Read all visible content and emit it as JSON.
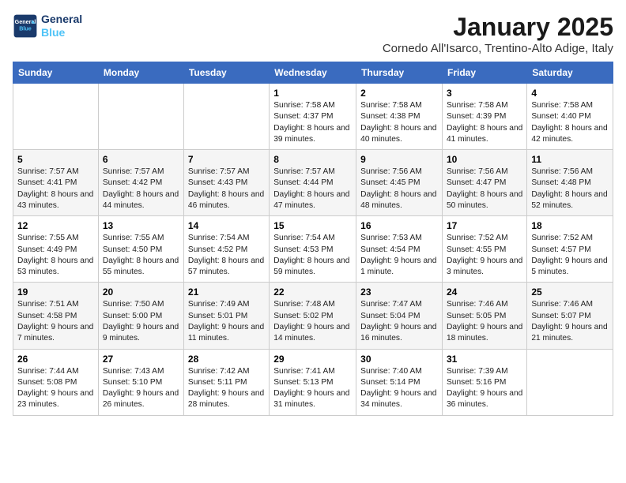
{
  "header": {
    "logo_line1": "General",
    "logo_line2": "Blue",
    "month": "January 2025",
    "location": "Cornedo All'Isarco, Trentino-Alto Adige, Italy"
  },
  "weekdays": [
    "Sunday",
    "Monday",
    "Tuesday",
    "Wednesday",
    "Thursday",
    "Friday",
    "Saturday"
  ],
  "weeks": [
    [
      {
        "day": "",
        "info": ""
      },
      {
        "day": "",
        "info": ""
      },
      {
        "day": "",
        "info": ""
      },
      {
        "day": "1",
        "info": "Sunrise: 7:58 AM\nSunset: 4:37 PM\nDaylight: 8 hours and 39 minutes."
      },
      {
        "day": "2",
        "info": "Sunrise: 7:58 AM\nSunset: 4:38 PM\nDaylight: 8 hours and 40 minutes."
      },
      {
        "day": "3",
        "info": "Sunrise: 7:58 AM\nSunset: 4:39 PM\nDaylight: 8 hours and 41 minutes."
      },
      {
        "day": "4",
        "info": "Sunrise: 7:58 AM\nSunset: 4:40 PM\nDaylight: 8 hours and 42 minutes."
      }
    ],
    [
      {
        "day": "5",
        "info": "Sunrise: 7:57 AM\nSunset: 4:41 PM\nDaylight: 8 hours and 43 minutes."
      },
      {
        "day": "6",
        "info": "Sunrise: 7:57 AM\nSunset: 4:42 PM\nDaylight: 8 hours and 44 minutes."
      },
      {
        "day": "7",
        "info": "Sunrise: 7:57 AM\nSunset: 4:43 PM\nDaylight: 8 hours and 46 minutes."
      },
      {
        "day": "8",
        "info": "Sunrise: 7:57 AM\nSunset: 4:44 PM\nDaylight: 8 hours and 47 minutes."
      },
      {
        "day": "9",
        "info": "Sunrise: 7:56 AM\nSunset: 4:45 PM\nDaylight: 8 hours and 48 minutes."
      },
      {
        "day": "10",
        "info": "Sunrise: 7:56 AM\nSunset: 4:47 PM\nDaylight: 8 hours and 50 minutes."
      },
      {
        "day": "11",
        "info": "Sunrise: 7:56 AM\nSunset: 4:48 PM\nDaylight: 8 hours and 52 minutes."
      }
    ],
    [
      {
        "day": "12",
        "info": "Sunrise: 7:55 AM\nSunset: 4:49 PM\nDaylight: 8 hours and 53 minutes."
      },
      {
        "day": "13",
        "info": "Sunrise: 7:55 AM\nSunset: 4:50 PM\nDaylight: 8 hours and 55 minutes."
      },
      {
        "day": "14",
        "info": "Sunrise: 7:54 AM\nSunset: 4:52 PM\nDaylight: 8 hours and 57 minutes."
      },
      {
        "day": "15",
        "info": "Sunrise: 7:54 AM\nSunset: 4:53 PM\nDaylight: 8 hours and 59 minutes."
      },
      {
        "day": "16",
        "info": "Sunrise: 7:53 AM\nSunset: 4:54 PM\nDaylight: 9 hours and 1 minute."
      },
      {
        "day": "17",
        "info": "Sunrise: 7:52 AM\nSunset: 4:55 PM\nDaylight: 9 hours and 3 minutes."
      },
      {
        "day": "18",
        "info": "Sunrise: 7:52 AM\nSunset: 4:57 PM\nDaylight: 9 hours and 5 minutes."
      }
    ],
    [
      {
        "day": "19",
        "info": "Sunrise: 7:51 AM\nSunset: 4:58 PM\nDaylight: 9 hours and 7 minutes."
      },
      {
        "day": "20",
        "info": "Sunrise: 7:50 AM\nSunset: 5:00 PM\nDaylight: 9 hours and 9 minutes."
      },
      {
        "day": "21",
        "info": "Sunrise: 7:49 AM\nSunset: 5:01 PM\nDaylight: 9 hours and 11 minutes."
      },
      {
        "day": "22",
        "info": "Sunrise: 7:48 AM\nSunset: 5:02 PM\nDaylight: 9 hours and 14 minutes."
      },
      {
        "day": "23",
        "info": "Sunrise: 7:47 AM\nSunset: 5:04 PM\nDaylight: 9 hours and 16 minutes."
      },
      {
        "day": "24",
        "info": "Sunrise: 7:46 AM\nSunset: 5:05 PM\nDaylight: 9 hours and 18 minutes."
      },
      {
        "day": "25",
        "info": "Sunrise: 7:46 AM\nSunset: 5:07 PM\nDaylight: 9 hours and 21 minutes."
      }
    ],
    [
      {
        "day": "26",
        "info": "Sunrise: 7:44 AM\nSunset: 5:08 PM\nDaylight: 9 hours and 23 minutes."
      },
      {
        "day": "27",
        "info": "Sunrise: 7:43 AM\nSunset: 5:10 PM\nDaylight: 9 hours and 26 minutes."
      },
      {
        "day": "28",
        "info": "Sunrise: 7:42 AM\nSunset: 5:11 PM\nDaylight: 9 hours and 28 minutes."
      },
      {
        "day": "29",
        "info": "Sunrise: 7:41 AM\nSunset: 5:13 PM\nDaylight: 9 hours and 31 minutes."
      },
      {
        "day": "30",
        "info": "Sunrise: 7:40 AM\nSunset: 5:14 PM\nDaylight: 9 hours and 34 minutes."
      },
      {
        "day": "31",
        "info": "Sunrise: 7:39 AM\nSunset: 5:16 PM\nDaylight: 9 hours and 36 minutes."
      },
      {
        "day": "",
        "info": ""
      }
    ]
  ]
}
